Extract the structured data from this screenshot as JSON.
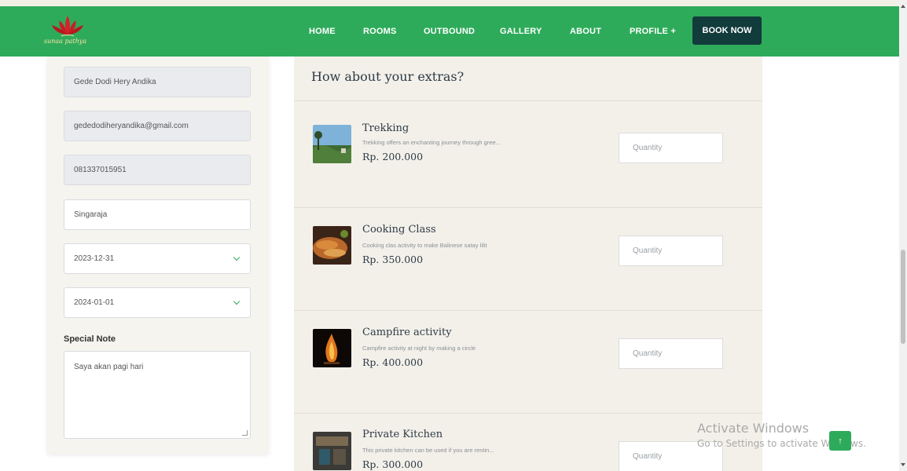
{
  "header": {
    "logo_text": "sunaa pathya",
    "nav": [
      "HOME",
      "ROOMS",
      "OUTBOUND",
      "GALLERY",
      "ABOUT",
      "PROFILE  +"
    ],
    "book_now": "BOOK NOW",
    "brand_color": "#2eab5a",
    "book_color": "#123b3b"
  },
  "form": {
    "name": "Gede Dodi Hery Andika",
    "email": "gededodiheryandika@gmail.com",
    "phone": "081337015951",
    "city": "Singaraja",
    "check_in": "2023-12-31",
    "check_out": "2024-01-01",
    "note_label": "Special Note",
    "note_value": "Saya akan pagi hari"
  },
  "extras": {
    "title": "How about your extras?",
    "quantity_placeholder": "Quantity",
    "items": [
      {
        "name": "Trekking",
        "desc": "Trekking offers an enchanting journey through gree...",
        "price": "Rp. 200.000",
        "icon": "trekking-photo"
      },
      {
        "name": "Cooking Class",
        "desc": "Cooking clas activity to make Balinese satay lilit",
        "price": "Rp. 350.000",
        "icon": "cooking-photo"
      },
      {
        "name": "Campfire activity",
        "desc": "Campfire activity at night by making a circle",
        "price": "Rp. 400.000",
        "icon": "campfire-photo"
      },
      {
        "name": "Private Kitchen",
        "desc": "This private kitchen can be used if you are rentin...",
        "price": "Rp. 300.000",
        "icon": "kitchen-photo"
      }
    ]
  },
  "watermark": {
    "line1": "Activate Windows",
    "line2": "Go to Settings to activate Windows."
  },
  "to_top": "↑"
}
